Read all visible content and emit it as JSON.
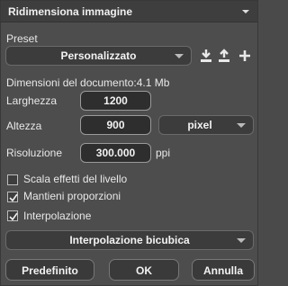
{
  "header": {
    "title": "Ridimensiona immagine",
    "menu_icon": "chevron-down-icon"
  },
  "preset": {
    "label": "Preset",
    "value": "Personalizzato",
    "icons": [
      "download-icon",
      "upload-icon",
      "plus-icon"
    ]
  },
  "document_size": {
    "label": "Dimensioni del documento:",
    "value": "4.1 Mb"
  },
  "width": {
    "label": "Larghezza",
    "value": "1200"
  },
  "height": {
    "label": "Altezza",
    "value": "900",
    "unit": "pixel"
  },
  "resolution": {
    "label": "Risoluzione",
    "value": "300.000",
    "unit": "ppi"
  },
  "options": [
    {
      "label": "Scala effetti del livello",
      "checked": false
    },
    {
      "label": "Mantieni proporzioni",
      "checked": true
    },
    {
      "label": "Interpolazione",
      "checked": true
    }
  ],
  "interpolation": {
    "value": "Interpolazione bicubica"
  },
  "buttons": {
    "default": "Predefinito",
    "ok": "OK",
    "cancel": "Annulla"
  }
}
